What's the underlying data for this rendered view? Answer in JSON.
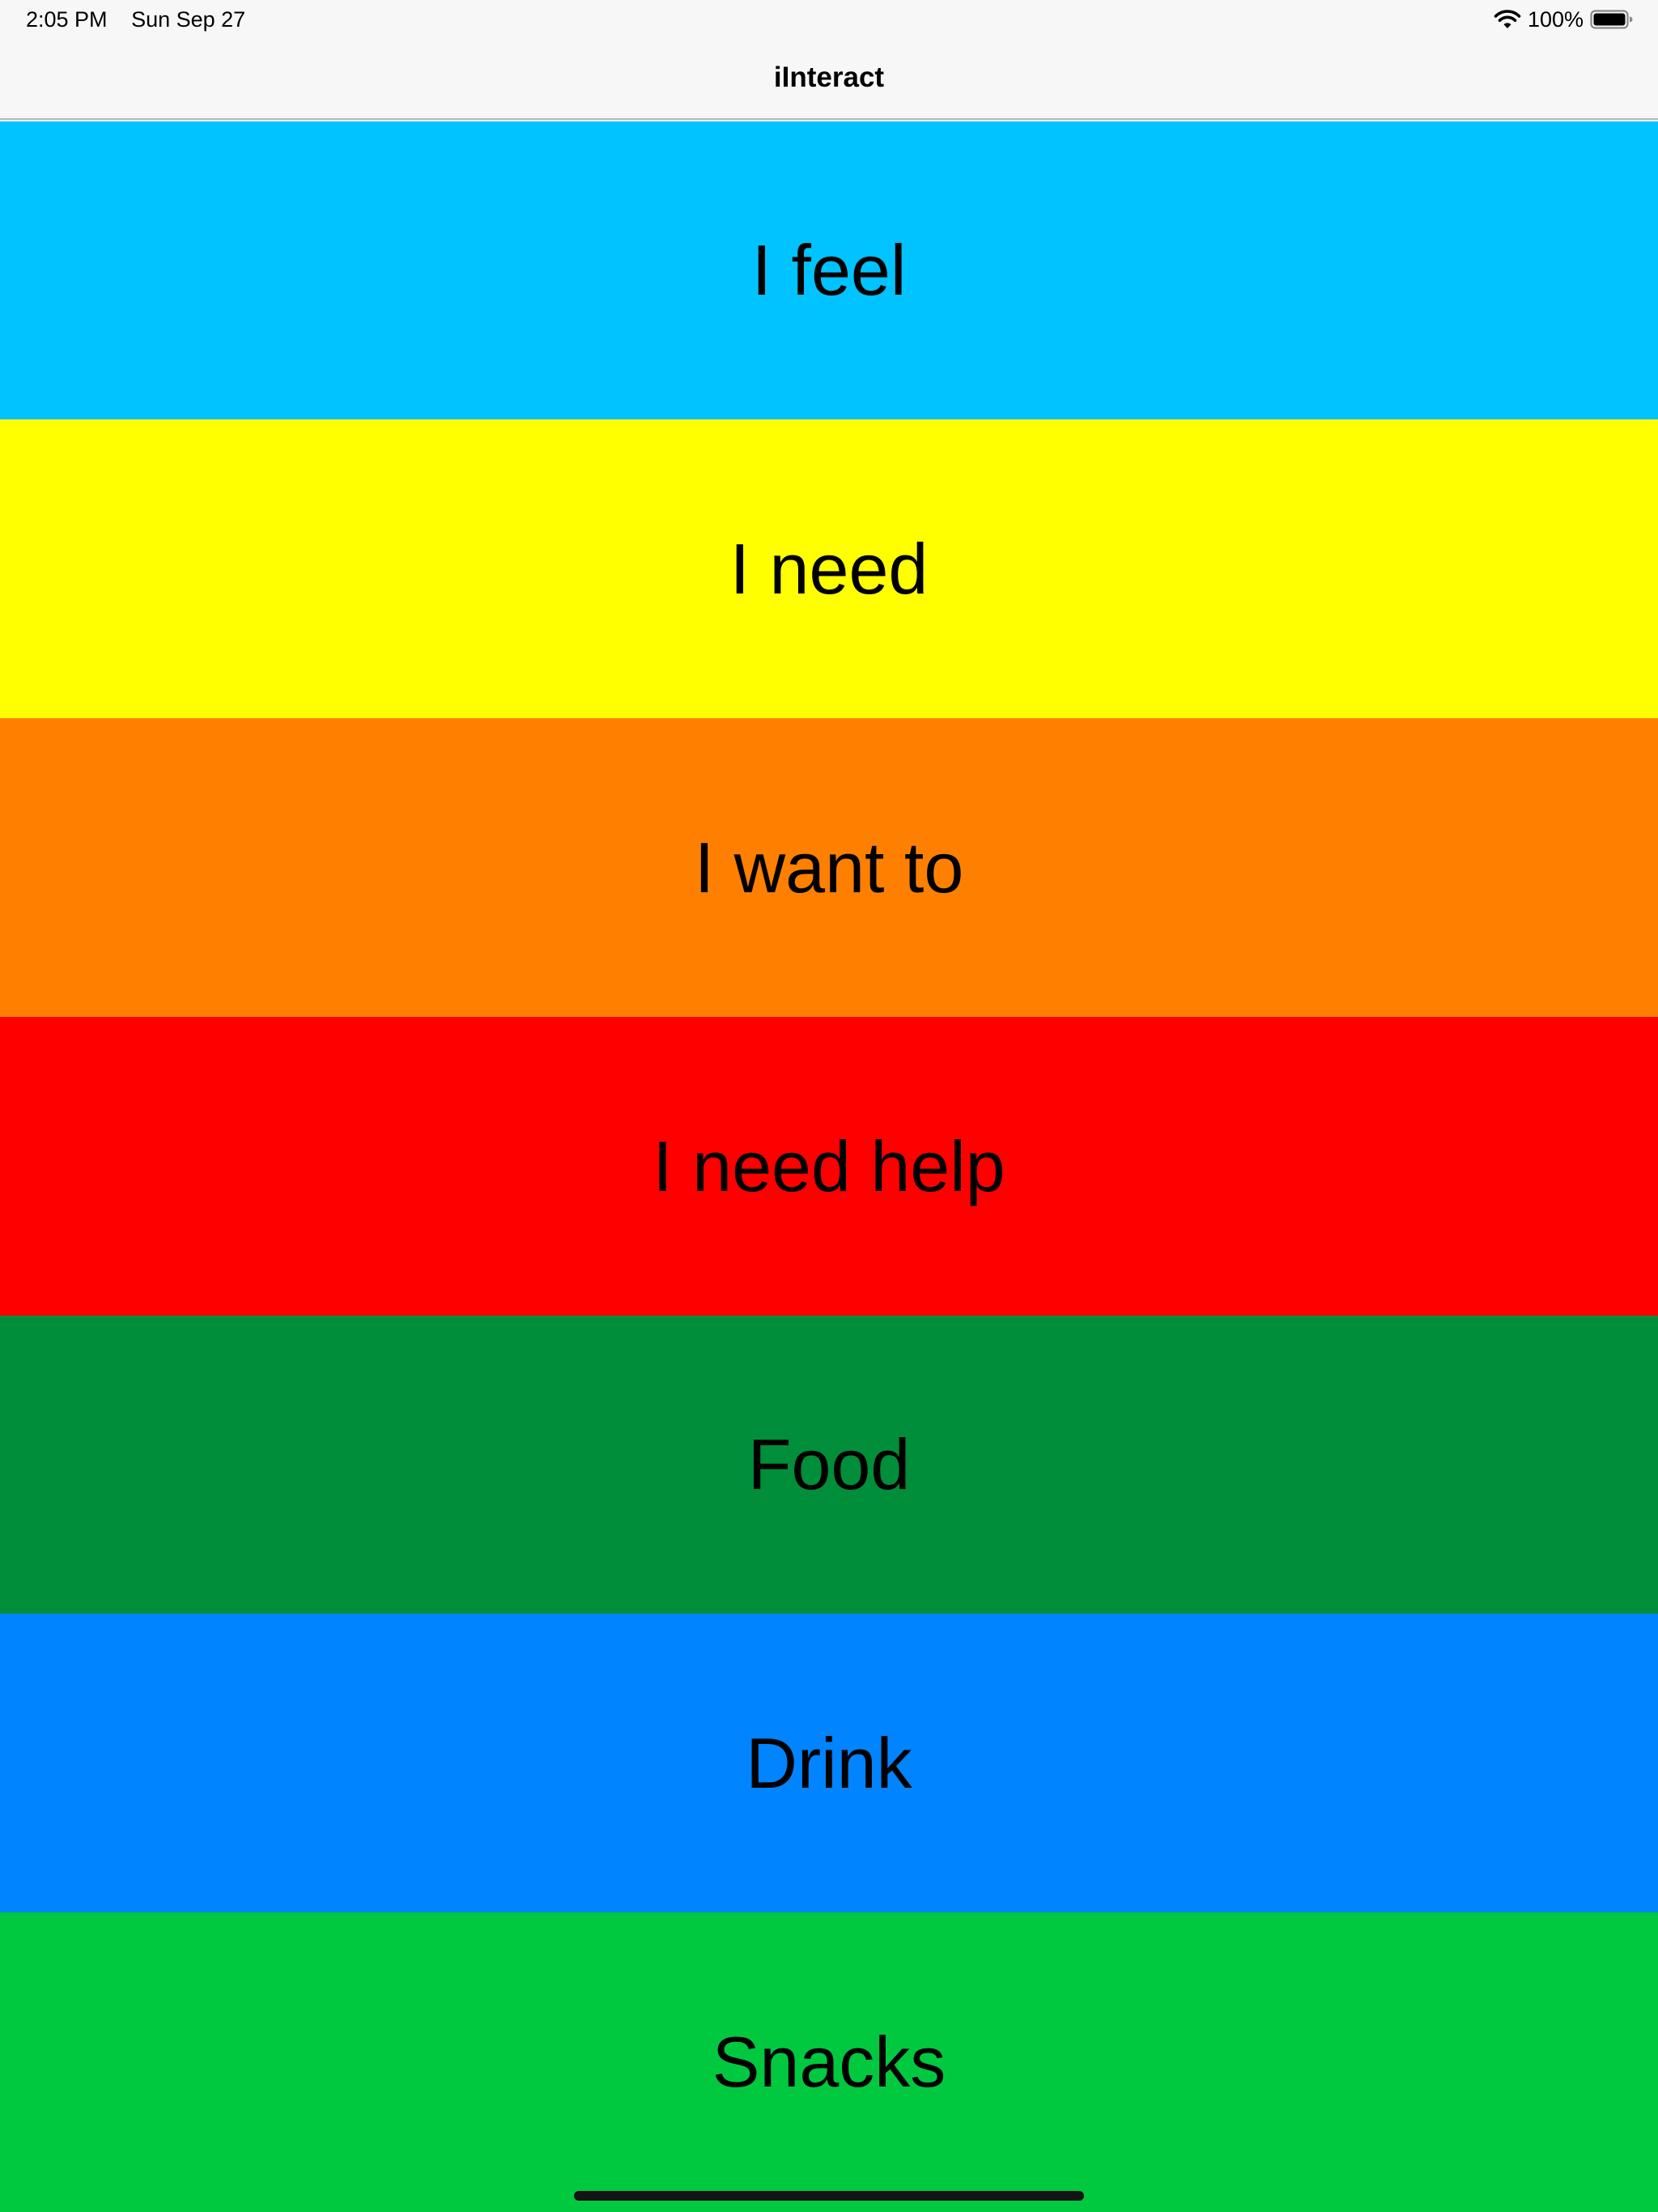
{
  "status_bar": {
    "time": "2:05 PM",
    "date": "Sun Sep 27",
    "battery_text": "100%",
    "wifi_icon": "wifi-icon",
    "battery_icon": "battery-icon"
  },
  "nav": {
    "title": "iInteract"
  },
  "tiles": [
    {
      "label": "I feel",
      "color": "#00c3ff"
    },
    {
      "label": "I need",
      "color": "#ffff00"
    },
    {
      "label": "I want to",
      "color": "#ff8000"
    },
    {
      "label": "I need help",
      "color": "#ff0000"
    },
    {
      "label": "Food",
      "color": "#008e3a"
    },
    {
      "label": "Drink",
      "color": "#0084ff"
    },
    {
      "label": "Snacks",
      "color": "#00c940"
    }
  ]
}
